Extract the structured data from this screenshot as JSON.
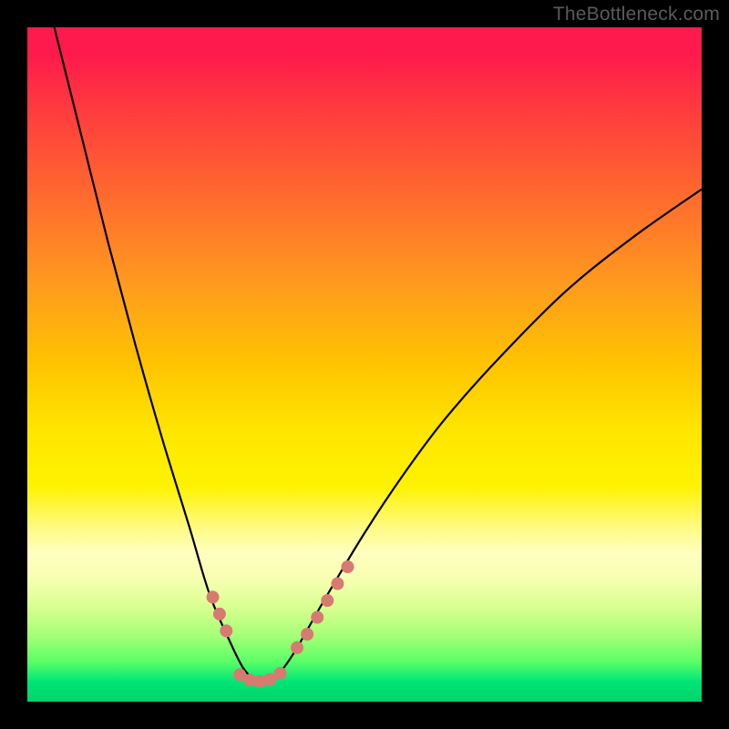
{
  "watermark": "TheBottleneck.com",
  "chart_data": {
    "type": "line",
    "title": "",
    "xlabel": "",
    "ylabel": "",
    "xlim": [
      0,
      100
    ],
    "ylim": [
      0,
      100
    ],
    "grid": false,
    "legend": false,
    "background_gradient": {
      "top_color": "#ff1a4d",
      "mid_color": "#ffe600",
      "bottom_color": "#00d26a"
    },
    "series": [
      {
        "name": "bottleneck-curve",
        "color": "#000000",
        "x": [
          4,
          8,
          12,
          16,
          20,
          24,
          27,
          30,
          32,
          33.5,
          35,
          36.5,
          38,
          40,
          44,
          50,
          56,
          62,
          70,
          80,
          90,
          100
        ],
        "y": [
          100,
          84,
          68,
          53,
          39,
          26,
          16,
          9,
          5,
          3.5,
          3,
          3.5,
          5,
          8,
          15,
          25,
          34,
          42,
          51,
          61,
          69,
          76
        ]
      },
      {
        "name": "highlight-dots-left",
        "color": "#d77a72",
        "type": "scatter",
        "x": [
          27.5,
          28.5,
          29.5
        ],
        "y": [
          15.5,
          13,
          10.5
        ]
      },
      {
        "name": "highlight-dots-right",
        "color": "#d77a72",
        "type": "scatter",
        "x": [
          40,
          41.5,
          43,
          44.5,
          46,
          47.5
        ],
        "y": [
          8,
          10,
          12.5,
          15,
          17.5,
          20
        ]
      },
      {
        "name": "highlight-bar-bottom",
        "color": "#d77a72",
        "type": "scatter",
        "x": [
          31.5,
          33,
          34.5,
          36,
          37.5
        ],
        "y": [
          4,
          3.2,
          3,
          3.3,
          4.2
        ]
      }
    ]
  }
}
